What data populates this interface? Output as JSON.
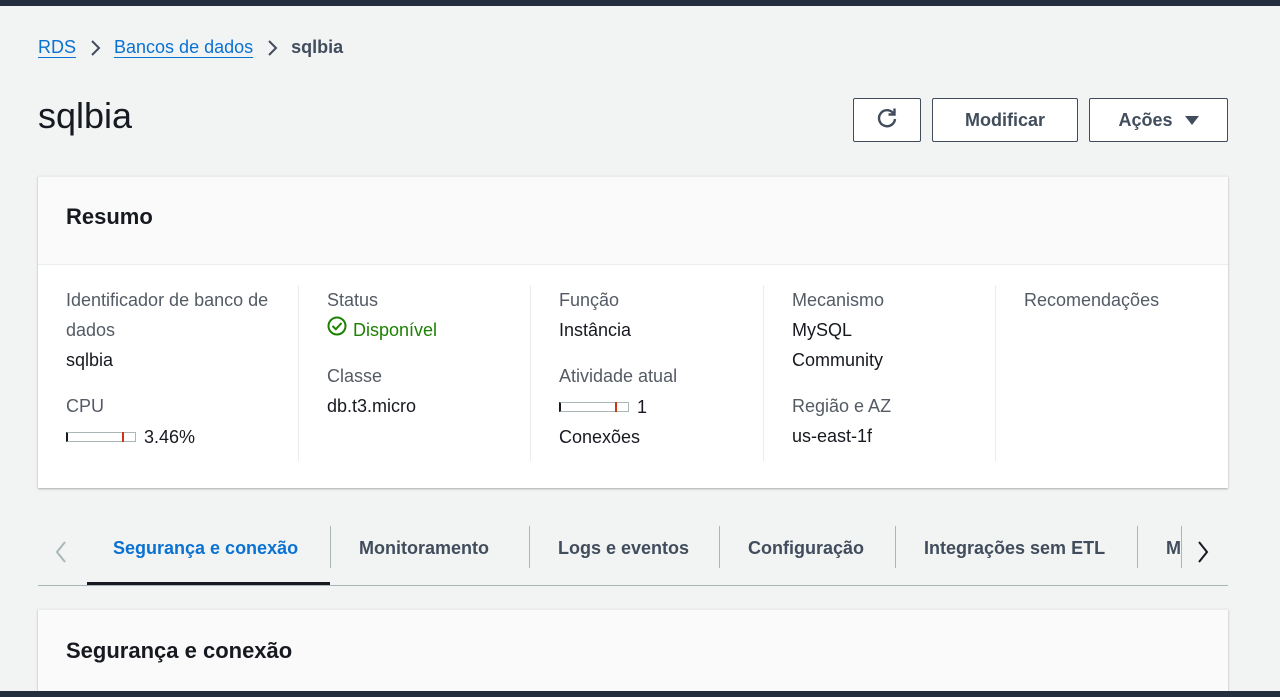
{
  "breadcrumb": {
    "items": [
      "RDS",
      "Bancos de dados"
    ],
    "current": "sqlbia"
  },
  "page": {
    "title": "sqlbia"
  },
  "actions": {
    "refresh_icon": "refresh-icon",
    "modify_label": "Modificar",
    "actions_label": "Ações"
  },
  "summary": {
    "title": "Resumo",
    "identifier_label": "Identificador de banco de dados",
    "identifier_value": "sqlbia",
    "cpu_label": "CPU",
    "cpu_value": "3.46%",
    "cpu_fraction": 0.0346,
    "status_label": "Status",
    "status_value": "Disponível",
    "class_label": "Classe",
    "class_value": "db.t3.micro",
    "role_label": "Função",
    "role_value": "Instância",
    "activity_label": "Atividade atual",
    "activity_value": "1",
    "activity_unit": "Conexões",
    "engine_label": "Mecanismo",
    "engine_value": "MySQL Community",
    "region_label": "Região e AZ",
    "region_value": "us-east-1f",
    "recommendations_label": "Recomendações"
  },
  "tabs": {
    "items": [
      "Segurança e conexão",
      "Monitoramento",
      "Logs e eventos",
      "Configuração",
      "Integrações sem ETL",
      "M"
    ],
    "active": "Segurança e conexão"
  },
  "section": {
    "title": "Segurança e conexão"
  },
  "colors": {
    "link": "#0972d3",
    "success": "#1d8102",
    "meter_tick": "#d13212",
    "header_dark": "#232f3e"
  }
}
